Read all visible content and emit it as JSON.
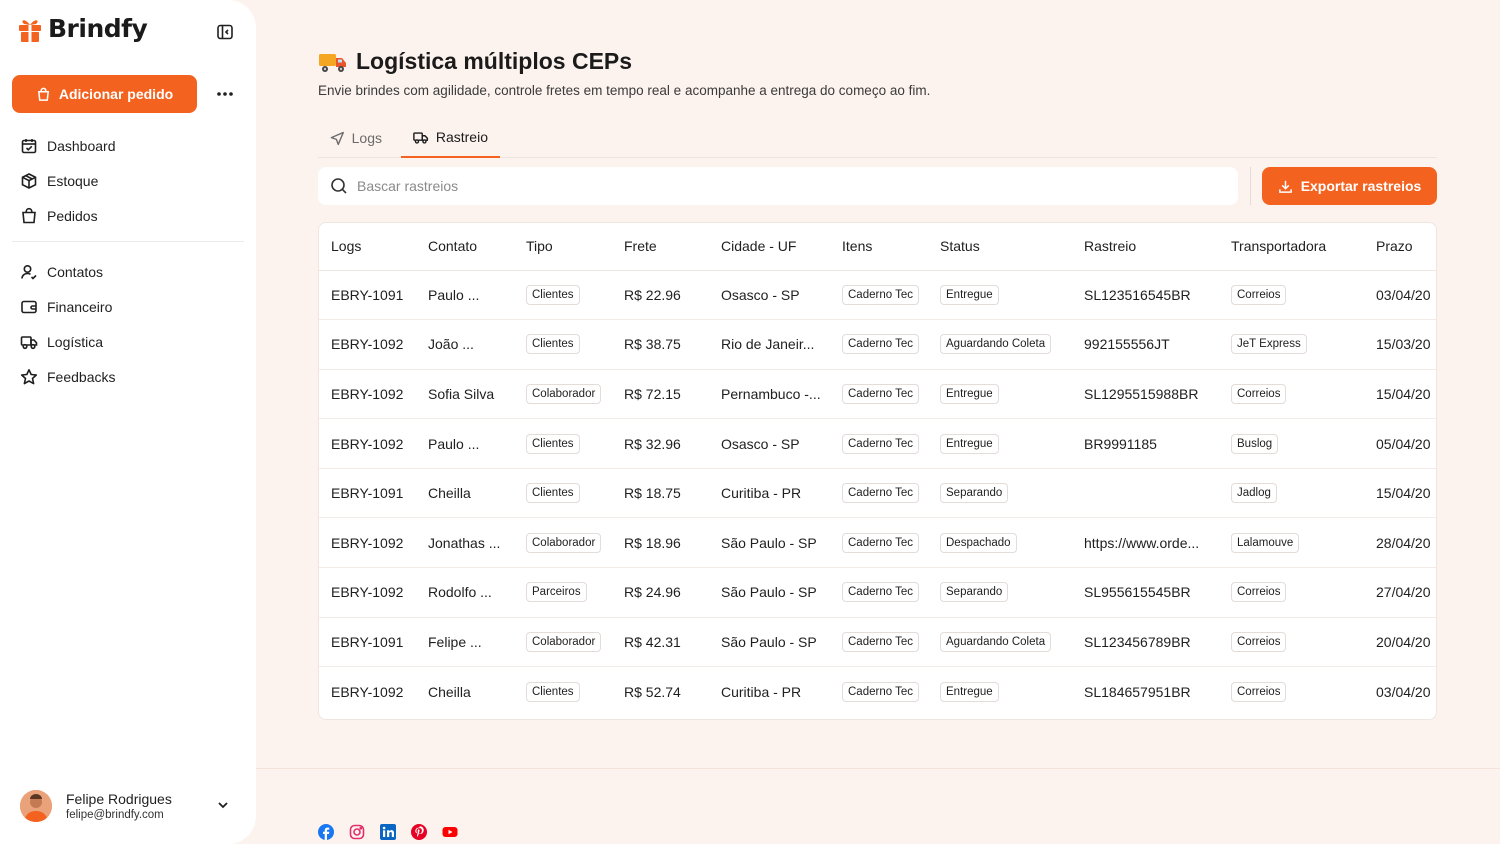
{
  "brand": {
    "name": "Brindfy",
    "accent": "#f4621f"
  },
  "sidebar": {
    "add_order_label": "Adicionar pedido",
    "nav_primary": [
      {
        "label": "Dashboard",
        "icon": "calendar-check-icon"
      },
      {
        "label": "Estoque",
        "icon": "package-icon"
      },
      {
        "label": "Pedidos",
        "icon": "shopping-bag-icon"
      }
    ],
    "nav_secondary": [
      {
        "label": "Contatos",
        "icon": "user-icon"
      },
      {
        "label": "Financeiro",
        "icon": "wallet-icon"
      },
      {
        "label": "Logística",
        "icon": "truck-icon"
      },
      {
        "label": "Feedbacks",
        "icon": "star-icon"
      }
    ],
    "user": {
      "name": "Felipe Rodrigues",
      "email": "felipe@brindfy.com"
    }
  },
  "page": {
    "title": "Logística múltiplos CEPs",
    "subtitle": "Envie brindes com agilidade, controle fretes em tempo real e acompanhe a entrega do começo ao fim.",
    "tabs": [
      {
        "label": "Logs",
        "active": false
      },
      {
        "label": "Rastreio",
        "active": true
      }
    ],
    "search_placeholder": "Bascar rastreios",
    "export_label": "Exportar rastreios"
  },
  "table": {
    "columns": [
      "Logs",
      "Contato",
      "Tipo",
      "Frete",
      "Cidade - UF",
      "Itens",
      "Status",
      "Rastreio",
      "Transportadora",
      "Prazo"
    ],
    "rows": [
      {
        "log": "EBRY-1091",
        "contato": "Paulo ...",
        "tipo": "Clientes",
        "frete": "R$ 22.96",
        "cidade": "Osasco - SP",
        "itens": "Caderno Tec",
        "status": "Entregue",
        "rastreio": "SL123516545BR",
        "transportadora": "Correios",
        "prazo": "03/04/20"
      },
      {
        "log": "EBRY-1092",
        "contato": "João ...",
        "tipo": "Clientes",
        "frete": "R$ 38.75",
        "cidade": "Rio de Janeir...",
        "itens": "Caderno Tec",
        "status": "Aguardando Coleta",
        "rastreio": "992155556JT",
        "transportadora": "JeT Express",
        "prazo": "15/03/20"
      },
      {
        "log": "EBRY-1092",
        "contato": "Sofia Silva",
        "tipo": "Colaborador",
        "frete": "R$ 72.15",
        "cidade": "Pernambuco -...",
        "itens": "Caderno Tec",
        "status": "Entregue",
        "rastreio": "SL1295515988BR",
        "transportadora": "Correios",
        "prazo": "15/04/20"
      },
      {
        "log": "EBRY-1092",
        "contato": "Paulo ...",
        "tipo": "Clientes",
        "frete": "R$ 32.96",
        "cidade": "Osasco - SP",
        "itens": "Caderno Tec",
        "status": "Entregue",
        "rastreio": "BR9991185",
        "transportadora": "Buslog",
        "prazo": "05/04/20"
      },
      {
        "log": "EBRY-1091",
        "contato": "Cheilla",
        "tipo": "Clientes",
        "frete": "R$ 18.75",
        "cidade": "Curitiba - PR",
        "itens": "Caderno Tec",
        "status": "Separando",
        "rastreio": "",
        "transportadora": "Jadlog",
        "prazo": "15/04/20"
      },
      {
        "log": "EBRY-1092",
        "contato": "Jonathas ...",
        "tipo": "Colaborador",
        "frete": "R$ 18.96",
        "cidade": "São Paulo - SP",
        "itens": "Caderno Tec",
        "status": "Despachado",
        "rastreio": "https://www.orde...",
        "transportadora": "Lalamouve",
        "prazo": "28/04/20"
      },
      {
        "log": "EBRY-1092",
        "contato": "Rodolfo ...",
        "tipo": "Parceiros",
        "frete": "R$ 24.96",
        "cidade": "São Paulo - SP",
        "itens": "Caderno Tec",
        "status": "Separando",
        "rastreio": "SL955615545BR",
        "transportadora": "Correios",
        "prazo": "27/04/20"
      },
      {
        "log": "EBRY-1091",
        "contato": "Felipe ...",
        "tipo": "Colaborador",
        "frete": "R$ 42.31",
        "cidade": "São Paulo - SP",
        "itens": "Caderno Tec",
        "status": "Aguardando Coleta",
        "rastreio": "SL123456789BR",
        "transportadora": "Correios",
        "prazo": "20/04/20"
      },
      {
        "log": "EBRY-1092",
        "contato": "Cheilla",
        "tipo": "Clientes",
        "frete": "R$ 52.74",
        "cidade": "Curitiba - PR",
        "itens": "Caderno Tec",
        "status": "Entregue",
        "rastreio": "SL184657951BR",
        "transportadora": "Correios",
        "prazo": "03/04/20"
      }
    ]
  },
  "footer": {
    "social": [
      {
        "icon": "facebook-icon",
        "color": "#1877f2"
      },
      {
        "icon": "instagram-icon",
        "color": "#e1306c"
      },
      {
        "icon": "linkedin-icon",
        "color": "#0a66c2"
      },
      {
        "icon": "pinterest-icon",
        "color": "#e60023"
      },
      {
        "icon": "youtube-icon",
        "color": "#ff0000"
      }
    ]
  }
}
